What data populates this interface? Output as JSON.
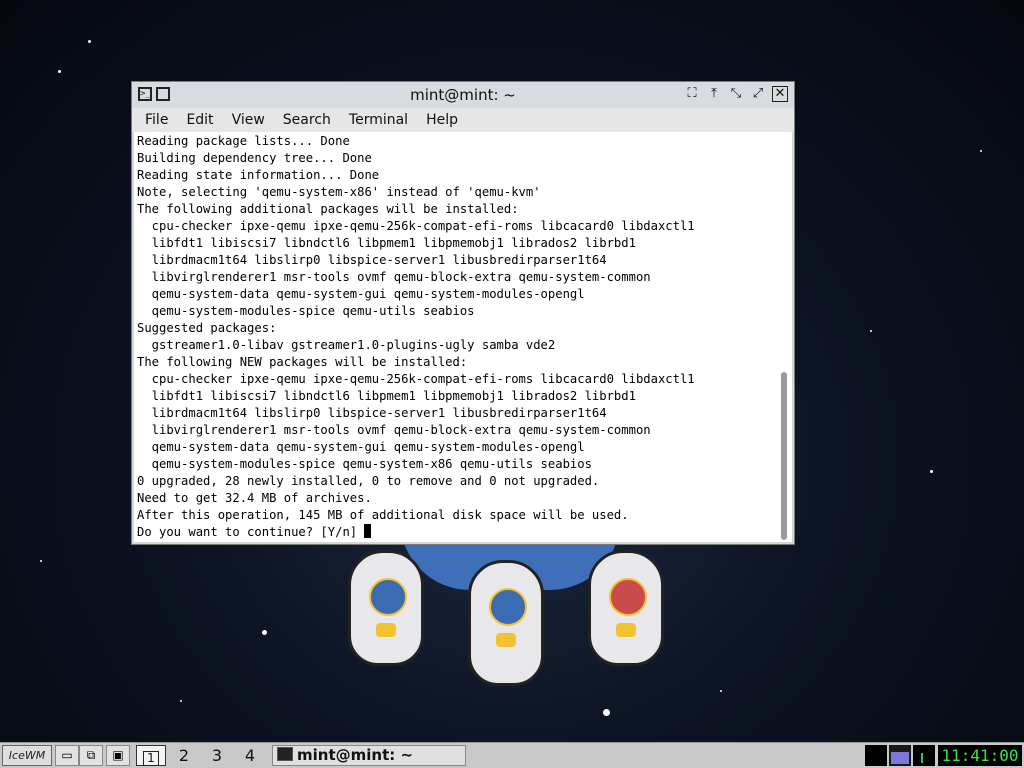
{
  "desktop": {
    "accent_color": "#0c1322"
  },
  "window": {
    "title": "mint@mint: ~",
    "system_menu_icon": ">_",
    "title_buttons": [
      "fullscreen-icon",
      "maximize-icon",
      "minimize-icon",
      "restore-icon",
      "close-icon"
    ],
    "menu": [
      "File",
      "Edit",
      "View",
      "Search",
      "Terminal",
      "Help"
    ]
  },
  "terminal": {
    "lines": [
      "Reading package lists... Done",
      "Building dependency tree... Done",
      "Reading state information... Done",
      "Note, selecting 'qemu-system-x86' instead of 'qemu-kvm'",
      "The following additional packages will be installed:",
      "  cpu-checker ipxe-qemu ipxe-qemu-256k-compat-efi-roms libcacard0 libdaxctl1",
      "  libfdt1 libiscsi7 libndctl6 libpmem1 libpmemobj1 librados2 librbd1",
      "  librdmacm1t64 libslirp0 libspice-server1 libusbredirparser1t64",
      "  libvirglrenderer1 msr-tools ovmf qemu-block-extra qemu-system-common",
      "  qemu-system-data qemu-system-gui qemu-system-modules-opengl",
      "  qemu-system-modules-spice qemu-utils seabios",
      "Suggested packages:",
      "  gstreamer1.0-libav gstreamer1.0-plugins-ugly samba vde2",
      "The following NEW packages will be installed:",
      "  cpu-checker ipxe-qemu ipxe-qemu-256k-compat-efi-roms libcacard0 libdaxctl1",
      "  libfdt1 libiscsi7 libndctl6 libpmem1 libpmemobj1 librados2 librbd1",
      "  librdmacm1t64 libslirp0 libspice-server1 libusbredirparser1t64",
      "  libvirglrenderer1 msr-tools ovmf qemu-block-extra qemu-system-common",
      "  qemu-system-data qemu-system-gui qemu-system-modules-opengl",
      "  qemu-system-modules-spice qemu-system-x86 qemu-utils seabios",
      "0 upgraded, 28 newly installed, 0 to remove and 0 not upgraded.",
      "Need to get 32.4 MB of archives.",
      "After this operation, 145 MB of additional disk space will be used."
    ],
    "prompt": "Do you want to continue? [Y/n] "
  },
  "taskbar": {
    "logo_text": "IceWM",
    "workspaces": [
      "1",
      "2",
      "3",
      "4"
    ],
    "active_workspace": "1",
    "task_label": "mint@mint: ~",
    "clock": "11:41:00",
    "clock_color": "#39e34f"
  }
}
